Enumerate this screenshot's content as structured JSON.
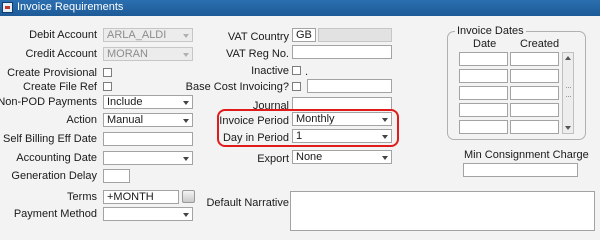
{
  "window": {
    "title": "Invoice Requirements",
    "icon": "app-window-icon"
  },
  "left": {
    "debit_account": {
      "label": "Debit Account",
      "value": "ARLA_ALDI"
    },
    "credit_account": {
      "label": "Credit Account",
      "value": "MORAN"
    },
    "create_provisional": {
      "label": "Create Provisional"
    },
    "create_file_ref": {
      "label": "Create File Ref"
    },
    "non_pod_payments": {
      "label": "Non-POD Payments",
      "value": "Include"
    },
    "action": {
      "label": "Action",
      "value": "Manual"
    },
    "self_billing_eff_date": {
      "label": "Self Billing Eff Date",
      "value": ""
    },
    "accounting_date": {
      "label": "Accounting Date",
      "value": ""
    },
    "generation_delay": {
      "label": "Generation Delay",
      "value": ""
    },
    "terms": {
      "label": "Terms",
      "value": "+MONTH"
    },
    "payment_method": {
      "label": "Payment Method",
      "value": ""
    }
  },
  "middle": {
    "vat_country": {
      "label": "VAT Country",
      "value": "GB"
    },
    "vat_reg_no": {
      "label": "VAT Reg No.",
      "value": ""
    },
    "inactive": {
      "label": "Inactive",
      "suffix": "."
    },
    "base_cost_invoicing": {
      "label": "Base Cost Invoicing?"
    },
    "journal": {
      "label": "Journal",
      "value": ""
    },
    "invoice_period": {
      "label": "Invoice Period",
      "value": "Monthly"
    },
    "day_in_period": {
      "label": "Day in Period",
      "value": "1"
    },
    "export": {
      "label": "Export",
      "value": "None"
    },
    "default_narrative": {
      "label": "Default Narrative",
      "value": ""
    }
  },
  "invoice_dates": {
    "title": "Invoice Dates",
    "columns": [
      "Date",
      "Created"
    ],
    "rows": [
      [
        "",
        ""
      ],
      [
        "",
        ""
      ],
      [
        "",
        ""
      ],
      [
        "",
        ""
      ],
      [
        "",
        ""
      ]
    ]
  },
  "min_consignment_charge": {
    "label": "Min Consignment Charge",
    "value": ""
  },
  "colors": {
    "highlight": "#e01b1b",
    "titlebar": "#1d5a97"
  }
}
